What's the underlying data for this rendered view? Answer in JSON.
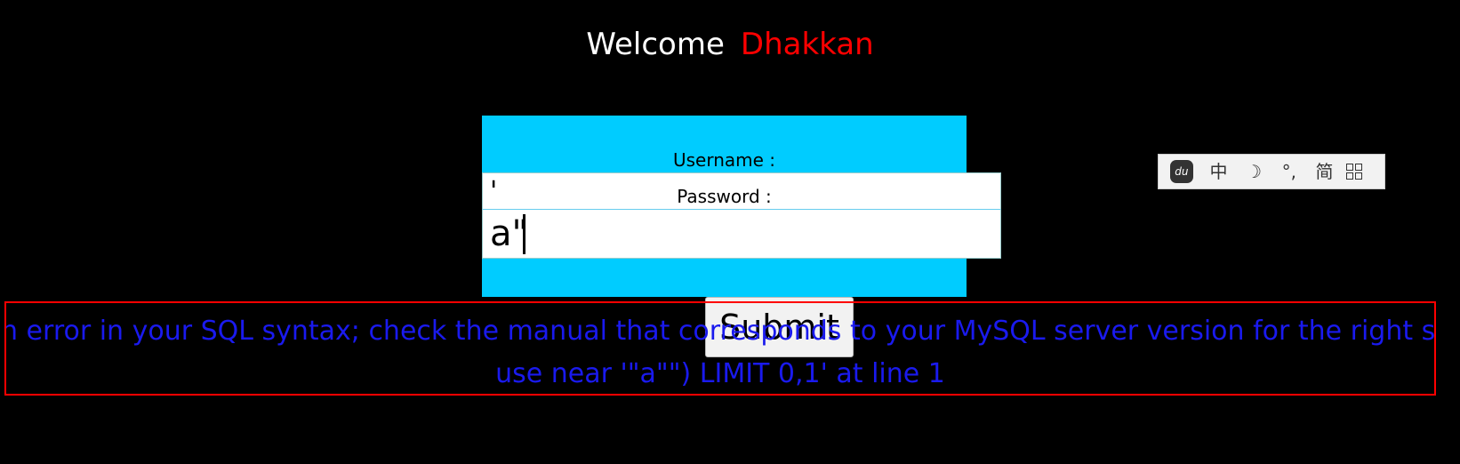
{
  "welcome": {
    "greeting": "Welcome",
    "name": "Dhakkan"
  },
  "form": {
    "username_label": "Username :",
    "password_label": "Password :",
    "username_value": "'",
    "password_value": "a\"",
    "submit_label": "Submit"
  },
  "error": {
    "line1": "n error in your SQL syntax; check the manual that corresponds to your MySQL server version for the right synt",
    "line2": "use near '\"a\"\") LIMIT 0,1' at line 1"
  },
  "ime_toolbar": {
    "logo_icon": "du-paw-icon",
    "chinese_mode": "中",
    "moon_icon": "☽",
    "punctuation": "°,",
    "simplified": "简",
    "menu_icon": "grid-icon"
  },
  "colors": {
    "background": "#000000",
    "panel": "#00ccff",
    "name": "#ff0000",
    "error_text": "#1a1aee",
    "error_border": "#ff0000"
  }
}
